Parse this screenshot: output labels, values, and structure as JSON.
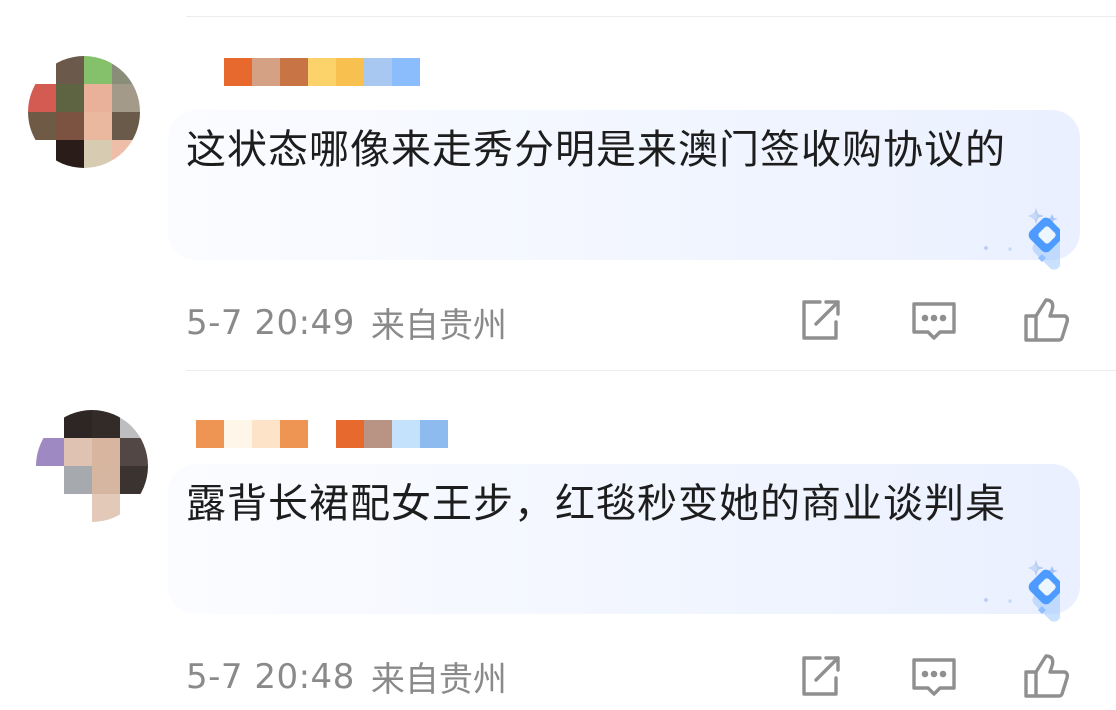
{
  "comments": [
    {
      "username_colors": [
        "#e8692e",
        "#d4a184",
        "#c87445",
        "#fcd36a",
        "#f7c04f",
        "#a9c8f1",
        "#8bbcfb"
      ],
      "avatar_colors": [
        "#ffffff",
        "#6b5a4b",
        "#85c06a",
        "#8a8d7a",
        "#d45b52",
        "#5e6341",
        "#e9b09a",
        "#a39a8a",
        "#6f5a45",
        "#7b5340",
        "#eab79f",
        "#6a5a4a",
        "#ffffff",
        "#2a1d19",
        "#d7ccb1",
        "#efbea8"
      ],
      "text": "这状态哪像来走秀分明是来澳门签收购协议的",
      "time": "5-7 20:49",
      "location": "来自贵州",
      "actions": [
        "share-icon",
        "comment-icon",
        "like-icon"
      ]
    },
    {
      "username_colors": [
        "#ee9553",
        "#fff6ea",
        "#fde3c7",
        "#ee9553",
        "#ffffff",
        "#e8692e",
        "#b99484",
        "#c4e2fb",
        "#8dbbf0"
      ],
      "avatar_colors": [
        "#ffffff",
        "#2e2624",
        "#332b28",
        "#bebec1",
        "#9e89c2",
        "#e0c2b2",
        "#d8b59f",
        "#524744",
        "#ffffff",
        "#a6aaae",
        "#d6b6a0",
        "#3b3330",
        "#ffffff",
        "#ffffff",
        "#e3c9b8",
        "#ffffff"
      ],
      "text": "露背长裙配女王步，红毯秒变她的商业谈判桌",
      "time": "5-7 20:48",
      "location": "来自贵州",
      "actions": [
        "share-icon",
        "comment-icon",
        "like-icon"
      ]
    }
  ],
  "colors": {
    "text": "#1d1d1d",
    "meta": "#8a8a8a",
    "icon": "#8f8f8f",
    "badge": "#5aa7ff"
  }
}
